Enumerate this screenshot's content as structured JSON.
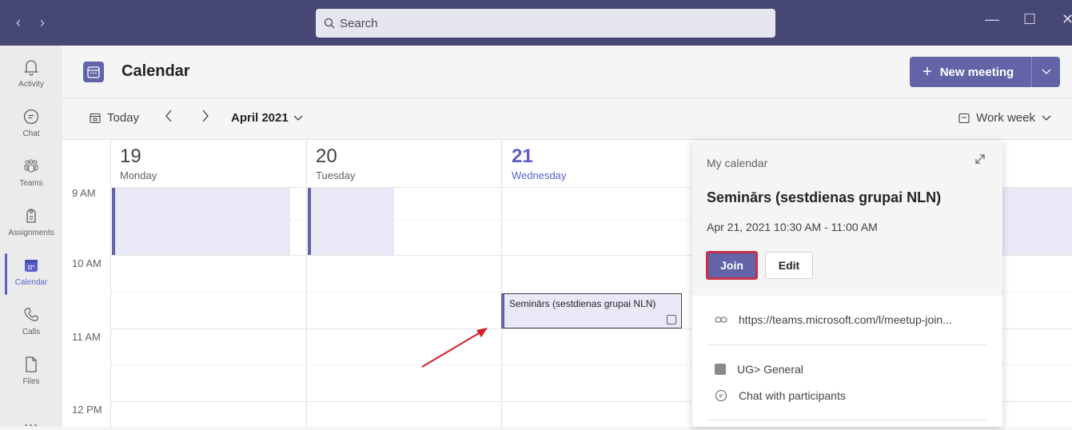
{
  "topbar": {
    "back_label": "‹",
    "forward_label": "›",
    "search_placeholder": "Search",
    "minimize_label": "—",
    "maximize_label": "☐",
    "close_label": "✕"
  },
  "rail": {
    "items": [
      {
        "label": "Activity",
        "icon": "bell-icon"
      },
      {
        "label": "Chat",
        "icon": "chat-icon"
      },
      {
        "label": "Teams",
        "icon": "teams-icon"
      },
      {
        "label": "Assignments",
        "icon": "assignments-icon"
      },
      {
        "label": "Calendar",
        "icon": "calendar-icon"
      },
      {
        "label": "Calls",
        "icon": "phone-icon"
      },
      {
        "label": "Files",
        "icon": "file-icon"
      }
    ],
    "more_label": "...",
    "active": "Calendar"
  },
  "header": {
    "title": "Calendar",
    "new_meeting_label": "New meeting"
  },
  "toolbar": {
    "today_label": "Today",
    "month_label": "April 2021",
    "view_label": "Work week"
  },
  "days": [
    {
      "num": "19",
      "name": "Monday"
    },
    {
      "num": "20",
      "name": "Tuesday"
    },
    {
      "num": "21",
      "name": "Wednesday"
    }
  ],
  "times": [
    "9 AM",
    "10 AM",
    "11 AM",
    "12 PM"
  ],
  "event": {
    "title": "Seminārs (sestdienas grupai NLN)"
  },
  "popup": {
    "calendar_label": "My calendar",
    "title": "Seminārs (sestdienas grupai NLN)",
    "time": "Apr 21, 2021 10:30 AM - 11:00 AM",
    "join_label": "Join",
    "edit_label": "Edit",
    "link": "https://teams.microsoft.com/l/meetup-join...",
    "channel": "UG> General",
    "chat_label": "Chat with participants"
  },
  "colors": {
    "brand": "#6264a7",
    "topbar": "#464775",
    "highlight_border": "#c4314b",
    "arrow": "#d0202a"
  }
}
